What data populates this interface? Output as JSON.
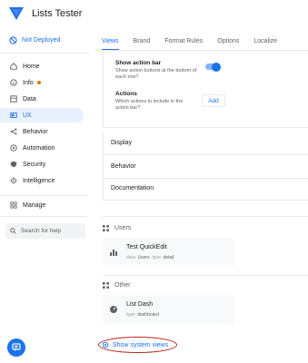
{
  "app": {
    "title": "Lists Tester"
  },
  "sidebar": {
    "deploy_status": "Not Deployed",
    "items": [
      {
        "label": "Home",
        "icon": "home-icon"
      },
      {
        "label": "Info",
        "icon": "info-icon",
        "badge": true
      },
      {
        "label": "Data",
        "icon": "data-icon"
      },
      {
        "label": "UX",
        "icon": "ux-icon",
        "active": true
      },
      {
        "label": "Behavior",
        "icon": "behavior-icon"
      },
      {
        "label": "Automation",
        "icon": "automation-icon"
      },
      {
        "label": "Security",
        "icon": "security-icon"
      },
      {
        "label": "Intelligence",
        "icon": "intelligence-icon"
      }
    ],
    "manage": "Manage",
    "search_placeholder": "Search for help"
  },
  "tabs": [
    "Views",
    "Brand",
    "Format Rules",
    "Options",
    "Localize"
  ],
  "active_tab": "Views",
  "settings": {
    "action_bar": {
      "title": "Show action bar",
      "desc": "Show action buttons at the bottom of each row?",
      "enabled": true
    },
    "actions": {
      "title": "Actions",
      "desc": "Which actions to include in the action bar?",
      "button": "Add"
    }
  },
  "sections": [
    "Display",
    "Behavior",
    "Documentation"
  ],
  "groups": [
    {
      "label": "Users",
      "card": {
        "title": "Test QuickEdit",
        "meta_k1": "data:",
        "meta_v1": "Users",
        "meta_k2": "type:",
        "meta_v2": "detail"
      }
    },
    {
      "label": "Other",
      "card": {
        "title": "List Dash",
        "meta_k1": "type:",
        "meta_v1": "dashboard"
      }
    }
  ],
  "show_system_views": "Show system views",
  "colors": {
    "accent": "#1a73e8",
    "active_bg": "#e8f0fe",
    "highlight": "#b3261e"
  }
}
